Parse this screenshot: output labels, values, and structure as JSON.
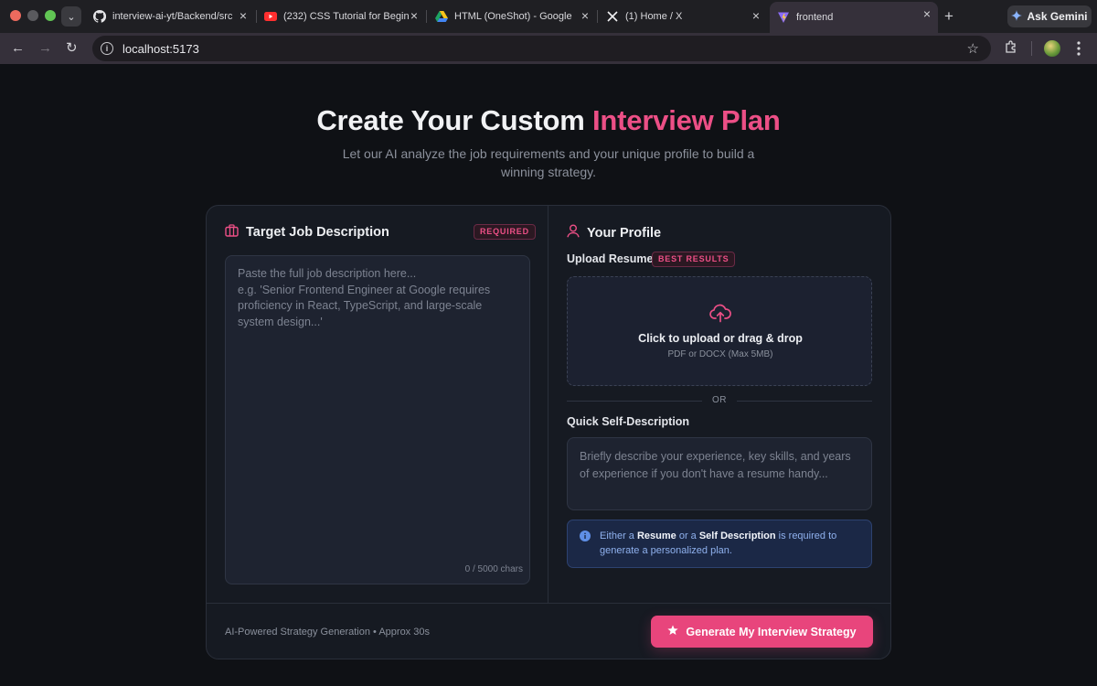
{
  "browser": {
    "tabs": [
      {
        "label": "interview-ai-yt/Backend/src",
        "icon": "github-icon"
      },
      {
        "label": "(232) CSS Tutorial for Begin",
        "icon": "youtube-icon"
      },
      {
        "label": "HTML (OneShot) - Google",
        "icon": "google-drive-icon"
      },
      {
        "label": "(1) Home / X",
        "icon": "x-icon"
      },
      {
        "label": "frontend",
        "icon": "vite-icon",
        "active": true
      }
    ],
    "ask_gemini": "Ask Gemini",
    "url": "localhost:5173"
  },
  "hero": {
    "title_main": "Create Your Custom ",
    "title_accent": "Interview Plan",
    "subtitle": "Let our AI analyze the job requirements and your unique profile to build a winning strategy."
  },
  "job": {
    "heading": "Target Job Description",
    "badge": "REQUIRED",
    "placeholder": "Paste the full job description here...\ne.g. 'Senior Frontend Engineer at Google requires proficiency in React, TypeScript, and large-scale system design...'",
    "char_count": "0 / 5000 chars"
  },
  "profile": {
    "heading": "Your Profile",
    "upload_label": "Upload Resume",
    "upload_badge": "BEST RESULTS",
    "upload_title": "Click to upload or drag & drop",
    "upload_sub": "PDF or DOCX (Max 5MB)",
    "or_text": "OR",
    "self_label": "Quick Self-Description",
    "self_placeholder": "Briefly describe your experience, key skills, and years of experience if you don't have a resume handy...",
    "notice": {
      "p1": "Either a ",
      "b1": "Resume",
      "p2": " or a ",
      "b2": "Self Description",
      "p3": " is required to generate a personalized plan."
    }
  },
  "footer": {
    "note": "AI-Powered Strategy Generation • Approx 30s",
    "cta": "Generate My Interview Strategy"
  },
  "colors": {
    "accent": "#ec4f86",
    "background": "#0f1115",
    "card": "#161a22",
    "info": "#8fb1ee"
  }
}
